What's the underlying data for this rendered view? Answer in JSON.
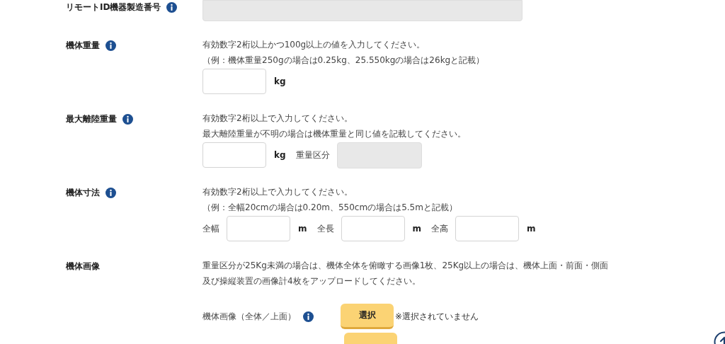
{
  "fields": [
    {
      "label": "リモートID機器製造番号",
      "info": true,
      "controls": [
        {
          "kind": "readonly_wide"
        }
      ]
    },
    {
      "label": "機体重量",
      "info": true,
      "help": [
        "有効数字2桁以上かつ100g以上の値を入力してください。",
        "（例：機体重量250gの場合は0.25kg、25.550kgの場合は26kgと記載）"
      ],
      "controls": [
        {
          "kind": "input"
        },
        {
          "kind": "unit",
          "text": "kg"
        }
      ]
    },
    {
      "label": "最大離陸重量",
      "info": true,
      "help": [
        "有効数字2桁以上で入力してください。",
        "最大離陸重量が不明の場合は機体重量と同じ値を記載してください。"
      ],
      "controls": [
        {
          "kind": "input"
        },
        {
          "kind": "unit",
          "text": "kg"
        },
        {
          "kind": "text",
          "text": "重量区分"
        },
        {
          "kind": "readonly"
        }
      ]
    },
    {
      "label": "機体寸法",
      "info": true,
      "help": [
        "有効数字2桁以上で入力してください。",
        "（例：全幅20cmの場合は0.20m、550cmの場合は5.5mと記載）"
      ],
      "controls": [
        {
          "kind": "text",
          "text": "全幅"
        },
        {
          "kind": "input"
        },
        {
          "kind": "unit",
          "text": "m"
        },
        {
          "kind": "text",
          "text": "全長"
        },
        {
          "kind": "input"
        },
        {
          "kind": "unit",
          "text": "m"
        },
        {
          "kind": "text",
          "text": "全高"
        },
        {
          "kind": "input"
        },
        {
          "kind": "unit",
          "text": "m"
        }
      ]
    },
    {
      "label": "機体画像",
      "help": [
        "重量区分が25Kg未満の場合は、機体全体を俯瞰する画像1枚、25Kg以上の場合は、機体上面・前面・側面",
        "及び操縦装置の画像計4枚をアップロードしてください。"
      ],
      "uploads": [
        {
          "label": "機体画像（全体／上面）",
          "info": true,
          "button": "選択",
          "status": "※選択されていません"
        }
      ]
    }
  ]
}
